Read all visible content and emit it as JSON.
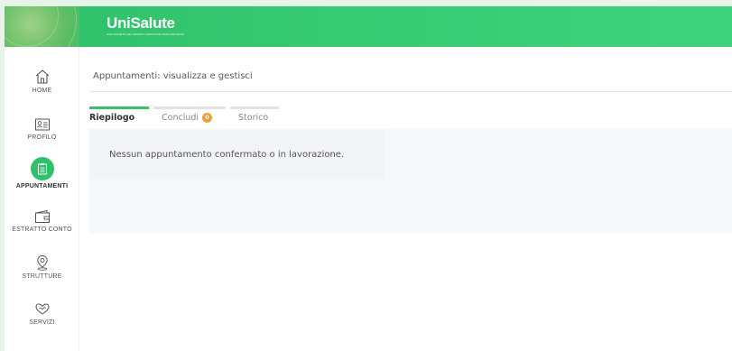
{
  "brand": {
    "logo_text": "UniSalute",
    "logo_subtitle": "UNA SOCIETÀ DEL GRUPPO UNIPOLSAI ASSICURAZIONI",
    "header_color": "#36c872"
  },
  "sidebar": {
    "items": [
      {
        "label": "HOME",
        "icon": "home-icon",
        "active": false
      },
      {
        "label": "PROFILO",
        "icon": "id-card-icon",
        "active": false
      },
      {
        "label": "APPUNTAMENTI",
        "icon": "clipboard-icon",
        "active": true
      },
      {
        "label": "ESTRATTO CONTO",
        "icon": "wallet-icon",
        "active": false
      },
      {
        "label": "STRUTTURE",
        "icon": "map-pin-icon",
        "active": false
      },
      {
        "label": "SERVIZI",
        "icon": "heart-hands-icon",
        "active": false
      }
    ],
    "active_color": "#2fc06a"
  },
  "main": {
    "page_title": "Appuntamenti: visualizza e gestisci",
    "tabs": [
      {
        "label": "Riepilogo",
        "active": true
      },
      {
        "label": "Concludi",
        "badge": "0",
        "active": false
      },
      {
        "label": "Storico",
        "active": false
      }
    ],
    "empty_message": "Nessun appuntamento confermato o in lavorazione."
  }
}
